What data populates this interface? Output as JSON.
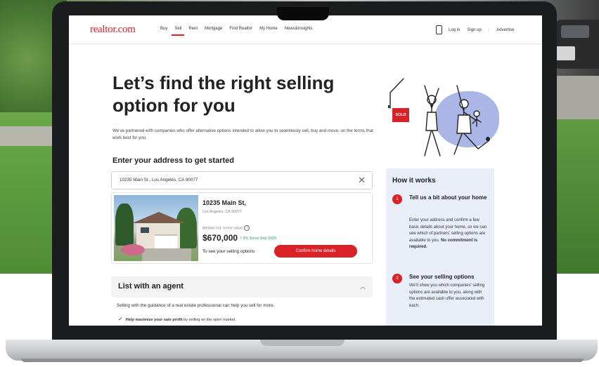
{
  "nav": {
    "logo": "realtor.com",
    "links": [
      "Buy",
      "Sell",
      "Rent",
      "Mortgage",
      "Find Realtor",
      "My Home",
      "News&Insights"
    ],
    "active_link": "Sell",
    "login": "Log in",
    "signup": "Sign up",
    "advertise": "Advertise"
  },
  "hero": {
    "headline": "Let’s find the right selling option for you",
    "subtext": "We’ve partnered with companies who offer alternative options intended to allow you to seamlessly sell, buy and move, on the terms that work best for you."
  },
  "address": {
    "heading": "Enter your address to get started",
    "value": "10235 Main St., Los Angeles, CA 90077"
  },
  "property": {
    "street": "10235 Main St,",
    "city": "Los Angeles, CA 90077",
    "value_label": "Median est. home value",
    "price": "$670,000",
    "change": "3% Since Sep 2020",
    "see_options": "To see your selling options",
    "confirm_button": "Confirm home details"
  },
  "agent": {
    "title": "List with an agent",
    "desc": "Selling with the guidance of a real estate professional can help you sell for more.",
    "check_bold": "Help maximize your sale profit",
    "check_rest": " by selling on the open market."
  },
  "illustration": {
    "sign": "SOLD"
  },
  "how": {
    "title": "How it works",
    "steps": [
      {
        "num": "1",
        "title": "Tell us a bit about your home",
        "text": "Enter your address and confirm a few basic details about your home, so we can see which of partners’ selling options are available to you.",
        "text_bold": "No commitment is required."
      },
      {
        "num": "2",
        "title": "See your selling options",
        "text": "We’ll show you which companies’ selling options are available to you, along with the estimated cash offer associated with each."
      }
    ]
  },
  "colors": {
    "accent": "#d92228",
    "panel": "#e9eef8",
    "blob": "#aab7e6",
    "positive": "#2a9d5c"
  }
}
